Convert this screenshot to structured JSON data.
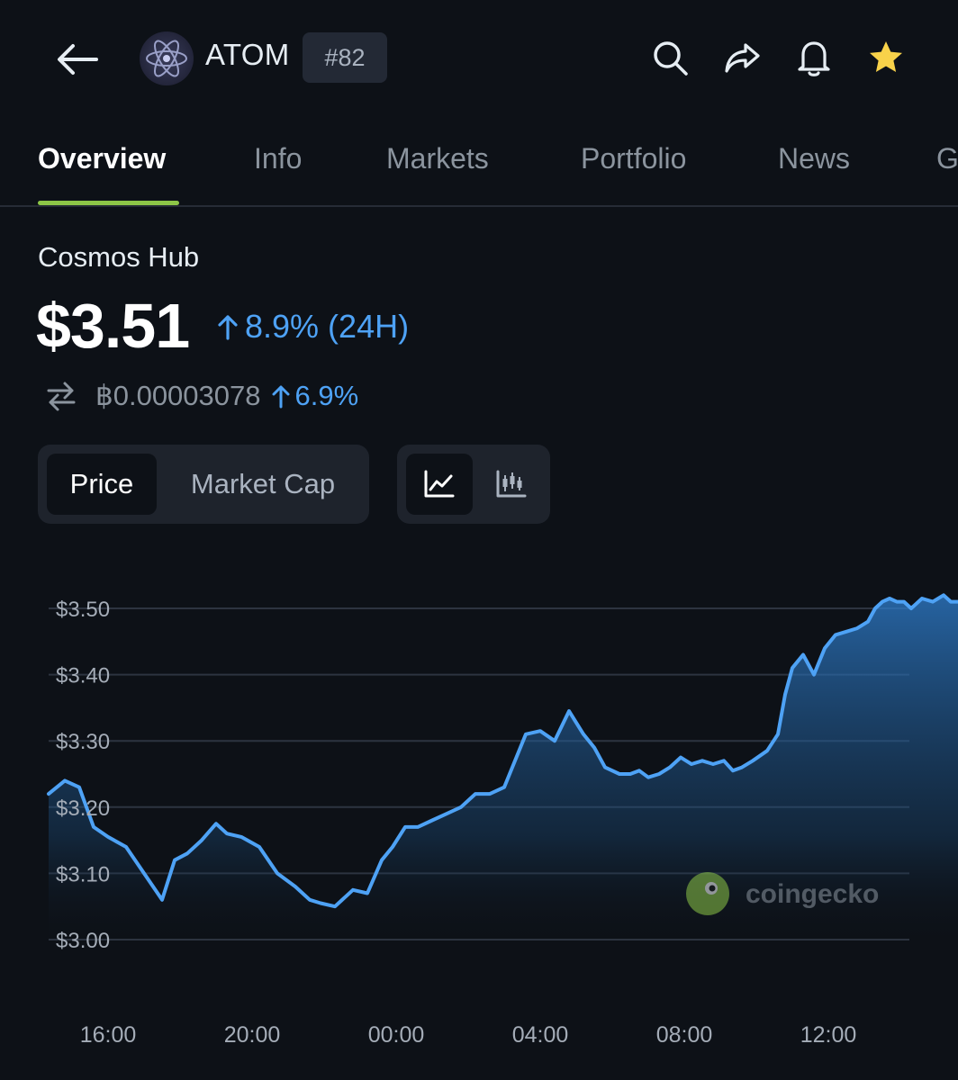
{
  "header": {
    "coin_symbol": "ATOM",
    "rank": "#82",
    "icons": [
      "back-arrow-icon",
      "cosmos-logo-icon",
      "search-icon",
      "share-icon",
      "bell-icon",
      "star-icon"
    ],
    "star_color": "#f8d24a"
  },
  "tabs": [
    {
      "label": "Overview",
      "active": true
    },
    {
      "label": "Info"
    },
    {
      "label": "Markets"
    },
    {
      "label": "Portfolio"
    },
    {
      "label": "News"
    },
    {
      "label": "G"
    }
  ],
  "coin": {
    "name": "Cosmos Hub",
    "price": "$3.51",
    "change_24h": "8.9% (24H)",
    "btc_price": "฿0.00003078",
    "btc_change": "6.9%"
  },
  "toggles": {
    "metric": [
      "Price",
      "Market Cap"
    ],
    "metric_selected": "Price",
    "chart_type": [
      "line-chart-icon",
      "candlestick-chart-icon"
    ],
    "chart_type_selected": "line-chart-icon"
  },
  "colors": {
    "accent_up": "#4ea2f5",
    "tab_indicator": "#8dc647",
    "line": "#4ea2f5"
  },
  "chart_data": {
    "type": "area",
    "ylim": [
      3.0,
      3.5
    ],
    "yticks": [
      "$3.50",
      "$3.40",
      "$3.30",
      "$3.20",
      "$3.10",
      "$3.00"
    ],
    "xticks": [
      "16:00",
      "20:00",
      "00:00",
      "04:00",
      "08:00",
      "12:00"
    ],
    "x_hours_from_1600": [
      -1.65,
      -1.2,
      -0.8,
      -0.4,
      0.0,
      0.5,
      1.0,
      1.5,
      1.85,
      2.2,
      2.6,
      3.0,
      3.3,
      3.7,
      4.2,
      4.7,
      5.2,
      5.6,
      5.9,
      6.3,
      6.8,
      7.2,
      7.6,
      7.9,
      8.25,
      8.6,
      9.0,
      9.4,
      9.8,
      10.2,
      10.6,
      11.0,
      11.3,
      11.6,
      12.0,
      12.4,
      12.8,
      13.2,
      13.5,
      13.8,
      14.2,
      14.5,
      14.75,
      15.0,
      15.3,
      15.6,
      15.9,
      16.2,
      16.5,
      16.8,
      17.1,
      17.35,
      17.6,
      17.9,
      18.3,
      18.6,
      18.8,
      19.0,
      19.3,
      19.6,
      19.9,
      20.2,
      20.5,
      20.8,
      21.1,
      21.3,
      21.5,
      21.7,
      21.9,
      22.1,
      22.3,
      22.6,
      22.9,
      23.2,
      23.4,
      23.6
    ],
    "values": [
      3.22,
      3.24,
      3.23,
      3.17,
      3.155,
      3.14,
      3.1,
      3.06,
      3.12,
      3.13,
      3.15,
      3.175,
      3.16,
      3.155,
      3.14,
      3.1,
      3.08,
      3.06,
      3.055,
      3.05,
      3.075,
      3.07,
      3.12,
      3.14,
      3.17,
      3.17,
      3.18,
      3.19,
      3.2,
      3.22,
      3.22,
      3.23,
      3.27,
      3.31,
      3.315,
      3.3,
      3.345,
      3.31,
      3.29,
      3.26,
      3.25,
      3.25,
      3.255,
      3.245,
      3.25,
      3.26,
      3.275,
      3.265,
      3.27,
      3.265,
      3.27,
      3.255,
      3.26,
      3.27,
      3.285,
      3.31,
      3.37,
      3.41,
      3.43,
      3.4,
      3.44,
      3.46,
      3.465,
      3.47,
      3.48,
      3.5,
      3.51,
      3.515,
      3.51,
      3.51,
      3.5,
      3.515,
      3.51,
      3.52,
      3.51,
      3.51
    ],
    "watermark": "coingecko"
  }
}
